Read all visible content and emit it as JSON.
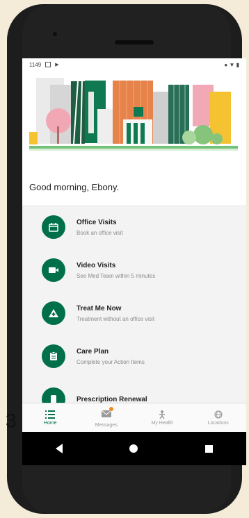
{
  "status_bar": {
    "time": "1149",
    "signal": "● ▼ ▮"
  },
  "greeting": "Good morning, Ebony.",
  "menu_items": [
    {
      "title": "Office Visits",
      "subtitle": "Book an office visit",
      "icon": "calendar-icon"
    },
    {
      "title": "Video Visits",
      "subtitle": "See Med Team within 5 minutes",
      "icon": "video-camera-icon"
    },
    {
      "title": "Treat Me Now",
      "subtitle": "Treatment without an office visit",
      "icon": "medical-kit-icon"
    },
    {
      "title": "Care Plan",
      "subtitle": "Complete your Action Items",
      "icon": "clipboard-icon"
    },
    {
      "title": "Prescription Renewal",
      "subtitle": "",
      "icon": "pill-icon"
    }
  ],
  "tabs": [
    {
      "label": "Home",
      "icon": "home-list-icon",
      "active": true
    },
    {
      "label": "Messages",
      "icon": "envelope-icon",
      "active": false
    },
    {
      "label": "My Health",
      "icon": "person-icon",
      "active": false
    },
    {
      "label": "Locations",
      "icon": "globe-icon",
      "active": false
    }
  ],
  "colors": {
    "accent": "#00704a",
    "badge": "#f28b20"
  },
  "partial_text": "3"
}
